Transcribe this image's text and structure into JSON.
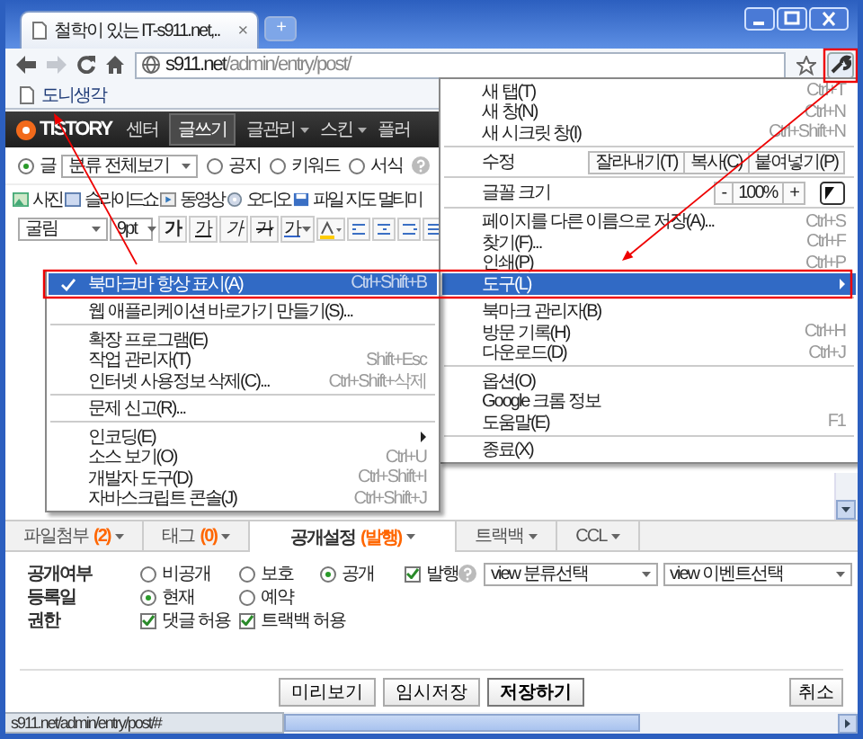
{
  "window": {
    "tab_title": "철학이 있는 IT-s911.net,..",
    "tab_close": "×",
    "new_tab": "+"
  },
  "toolbar": {
    "url_host": "s911.net",
    "url_path": "/admin/entry/post/"
  },
  "bookmarks": [
    {
      "label": "도니생각"
    }
  ],
  "blog": {
    "logo": "TISTORY",
    "nav": [
      {
        "label": "센터",
        "selected": false,
        "dropdown": false
      },
      {
        "label": "글쓰기",
        "selected": true,
        "dropdown": false
      },
      {
        "label": "글관리",
        "selected": false,
        "dropdown": true
      },
      {
        "label": "스킨",
        "selected": false,
        "dropdown": true
      },
      {
        "label": "플러",
        "selected": false,
        "dropdown": false
      }
    ],
    "post_type": [
      {
        "label": "글",
        "selected": true
      },
      {
        "label": "공지",
        "selected": false
      },
      {
        "label": "키워드",
        "selected": false
      },
      {
        "label": "서식",
        "selected": false
      }
    ],
    "category": "분류 전체보기",
    "insert_tools": [
      {
        "label": "사진",
        "kind": "photo"
      },
      {
        "label": "슬라이드쇼",
        "kind": "slideshow"
      },
      {
        "label": "동영상",
        "kind": "video"
      },
      {
        "label": "오디오",
        "kind": "audio"
      },
      {
        "label": "파일",
        "kind": "file"
      },
      {
        "label": "지도",
        "kind": "text"
      },
      {
        "label": "멀티미",
        "kind": "text"
      }
    ],
    "font": "굴림",
    "font_size": "9pt",
    "styles": [
      {
        "label": "가",
        "kind": "bold"
      },
      {
        "label": "가",
        "kind": "underline"
      },
      {
        "label": "가",
        "kind": "italic"
      },
      {
        "label": "가",
        "kind": "strike"
      },
      {
        "label": "가",
        "kind": "color"
      }
    ]
  },
  "wrench_menu": [
    {
      "kind": "item",
      "label": "새 탭(T)",
      "shortcut": "Ctrl+T",
      "selected": false,
      "submenu": false
    },
    {
      "kind": "item",
      "label": "새 창(N)",
      "shortcut": "Ctrl+N",
      "selected": false,
      "submenu": false
    },
    {
      "kind": "item",
      "label": "새 시크릿 창(I)",
      "shortcut": "Ctrl+Shift+N",
      "selected": false,
      "submenu": false
    },
    {
      "kind": "separator"
    },
    {
      "kind": "edit",
      "label": "수정",
      "buttons": [
        "잘라내기(T)",
        "복사(C)",
        "붙여넣기(P)"
      ]
    },
    {
      "kind": "separator"
    },
    {
      "kind": "zoom",
      "label": "글꼴 크기",
      "minus": "-",
      "value": "100%",
      "plus": "+"
    },
    {
      "kind": "separator"
    },
    {
      "kind": "item",
      "label": "페이지를 다른 이름으로 저장(A)...",
      "shortcut": "Ctrl+S",
      "selected": false,
      "submenu": false
    },
    {
      "kind": "item",
      "label": "찾기(F)...",
      "shortcut": "Ctrl+F",
      "selected": false,
      "submenu": false
    },
    {
      "kind": "item",
      "label": "인쇄(P)",
      "shortcut": "Ctrl+P",
      "selected": false,
      "submenu": false
    },
    {
      "kind": "item",
      "label": "도구(L)",
      "selected": true,
      "submenu": true
    },
    {
      "kind": "separator"
    },
    {
      "kind": "item",
      "label": "북마크 관리자(B)",
      "selected": false,
      "submenu": false
    },
    {
      "kind": "item",
      "label": "방문 기록(H)",
      "shortcut": "Ctrl+H",
      "selected": false,
      "submenu": false
    },
    {
      "kind": "item",
      "label": "다운로드(D)",
      "shortcut": "Ctrl+J",
      "selected": false,
      "submenu": false
    },
    {
      "kind": "separator"
    },
    {
      "kind": "item",
      "label": "옵션(O)",
      "selected": false,
      "submenu": false
    },
    {
      "kind": "item",
      "label": "Google 크롬 정보",
      "selected": false,
      "submenu": false
    },
    {
      "kind": "item",
      "label": "도움말(E)",
      "shortcut": "F1",
      "selected": false,
      "submenu": false
    },
    {
      "kind": "separator"
    },
    {
      "kind": "item",
      "label": "종료(X)",
      "selected": false,
      "submenu": false
    }
  ],
  "tools_menu": [
    {
      "kind": "item",
      "label": "북마크바 항상 표시(A)",
      "shortcut": "Ctrl+Shift+B",
      "selected": true,
      "checked": true,
      "submenu": false
    },
    {
      "kind": "separator"
    },
    {
      "kind": "item",
      "label": "웹 애플리케이션 바로가기 만들기(S)...",
      "selected": false,
      "checked": false,
      "submenu": false
    },
    {
      "kind": "separator"
    },
    {
      "kind": "item",
      "label": "확장 프로그램(E)",
      "selected": false,
      "checked": false,
      "submenu": false
    },
    {
      "kind": "item",
      "label": "작업 관리자(T)",
      "shortcut": "Shift+Esc",
      "selected": false,
      "checked": false,
      "submenu": false
    },
    {
      "kind": "item",
      "label": "인터넷 사용정보 삭제(C)...",
      "shortcut": "Ctrl+Shift+삭제",
      "selected": false,
      "checked": false,
      "submenu": false
    },
    {
      "kind": "separator"
    },
    {
      "kind": "item",
      "label": "문제 신고(R)...",
      "selected": false,
      "checked": false,
      "submenu": false
    },
    {
      "kind": "separator"
    },
    {
      "kind": "item",
      "label": "인코딩(E)",
      "selected": false,
      "checked": false,
      "submenu": true
    },
    {
      "kind": "item",
      "label": "소스 보기(O)",
      "shortcut": "Ctrl+U",
      "selected": false,
      "checked": false,
      "submenu": false
    },
    {
      "kind": "item",
      "label": "개발자 도구(D)",
      "shortcut": "Ctrl+Shift+I",
      "selected": false,
      "checked": false,
      "submenu": false
    },
    {
      "kind": "item",
      "label": "자바스크립트 콘솔(J)",
      "shortcut": "Ctrl+Shift+J",
      "selected": false,
      "checked": false,
      "submenu": false
    }
  ],
  "settings": {
    "tabs": [
      {
        "label": "파일첨부",
        "count": "(2)",
        "selected": false
      },
      {
        "label": "태그",
        "count": "(0)",
        "selected": false
      },
      {
        "label": "공개설정",
        "count": "(발행)",
        "selected": true
      },
      {
        "label": "트랙백",
        "selected": false
      },
      {
        "label": "CCL",
        "selected": false
      }
    ],
    "rows": [
      {
        "label": "공개여부",
        "options": [
          {
            "kind": "radio",
            "label": "비공개",
            "selected": false
          },
          {
            "kind": "radio",
            "label": "보호",
            "selected": false
          },
          {
            "kind": "radio",
            "label": "공개",
            "selected": true
          },
          {
            "kind": "checkbox",
            "label": "발행",
            "checked": true
          },
          {
            "kind": "help"
          },
          {
            "kind": "select",
            "value": "view 분류선택"
          },
          {
            "kind": "select",
            "value": "view 이벤트선택"
          }
        ]
      },
      {
        "label": "등록일",
        "options": [
          {
            "kind": "radio",
            "label": "현재",
            "selected": true
          },
          {
            "kind": "radio",
            "label": "예약",
            "selected": false
          }
        ]
      },
      {
        "label": "권한",
        "options": [
          {
            "kind": "checkbox",
            "label": "댓글 허용",
            "checked": true
          },
          {
            "kind": "checkbox",
            "label": "트랙백 허용",
            "checked": true
          }
        ]
      }
    ]
  },
  "actions": [
    {
      "label": "미리보기",
      "kind": "normal"
    },
    {
      "label": "임시저장",
      "kind": "normal"
    },
    {
      "label": "저장하기",
      "kind": "primary"
    },
    {
      "label": "취소",
      "kind": "cancel"
    }
  ],
  "status_bar": {
    "url": "s911.net/admin/entry/post/#"
  }
}
